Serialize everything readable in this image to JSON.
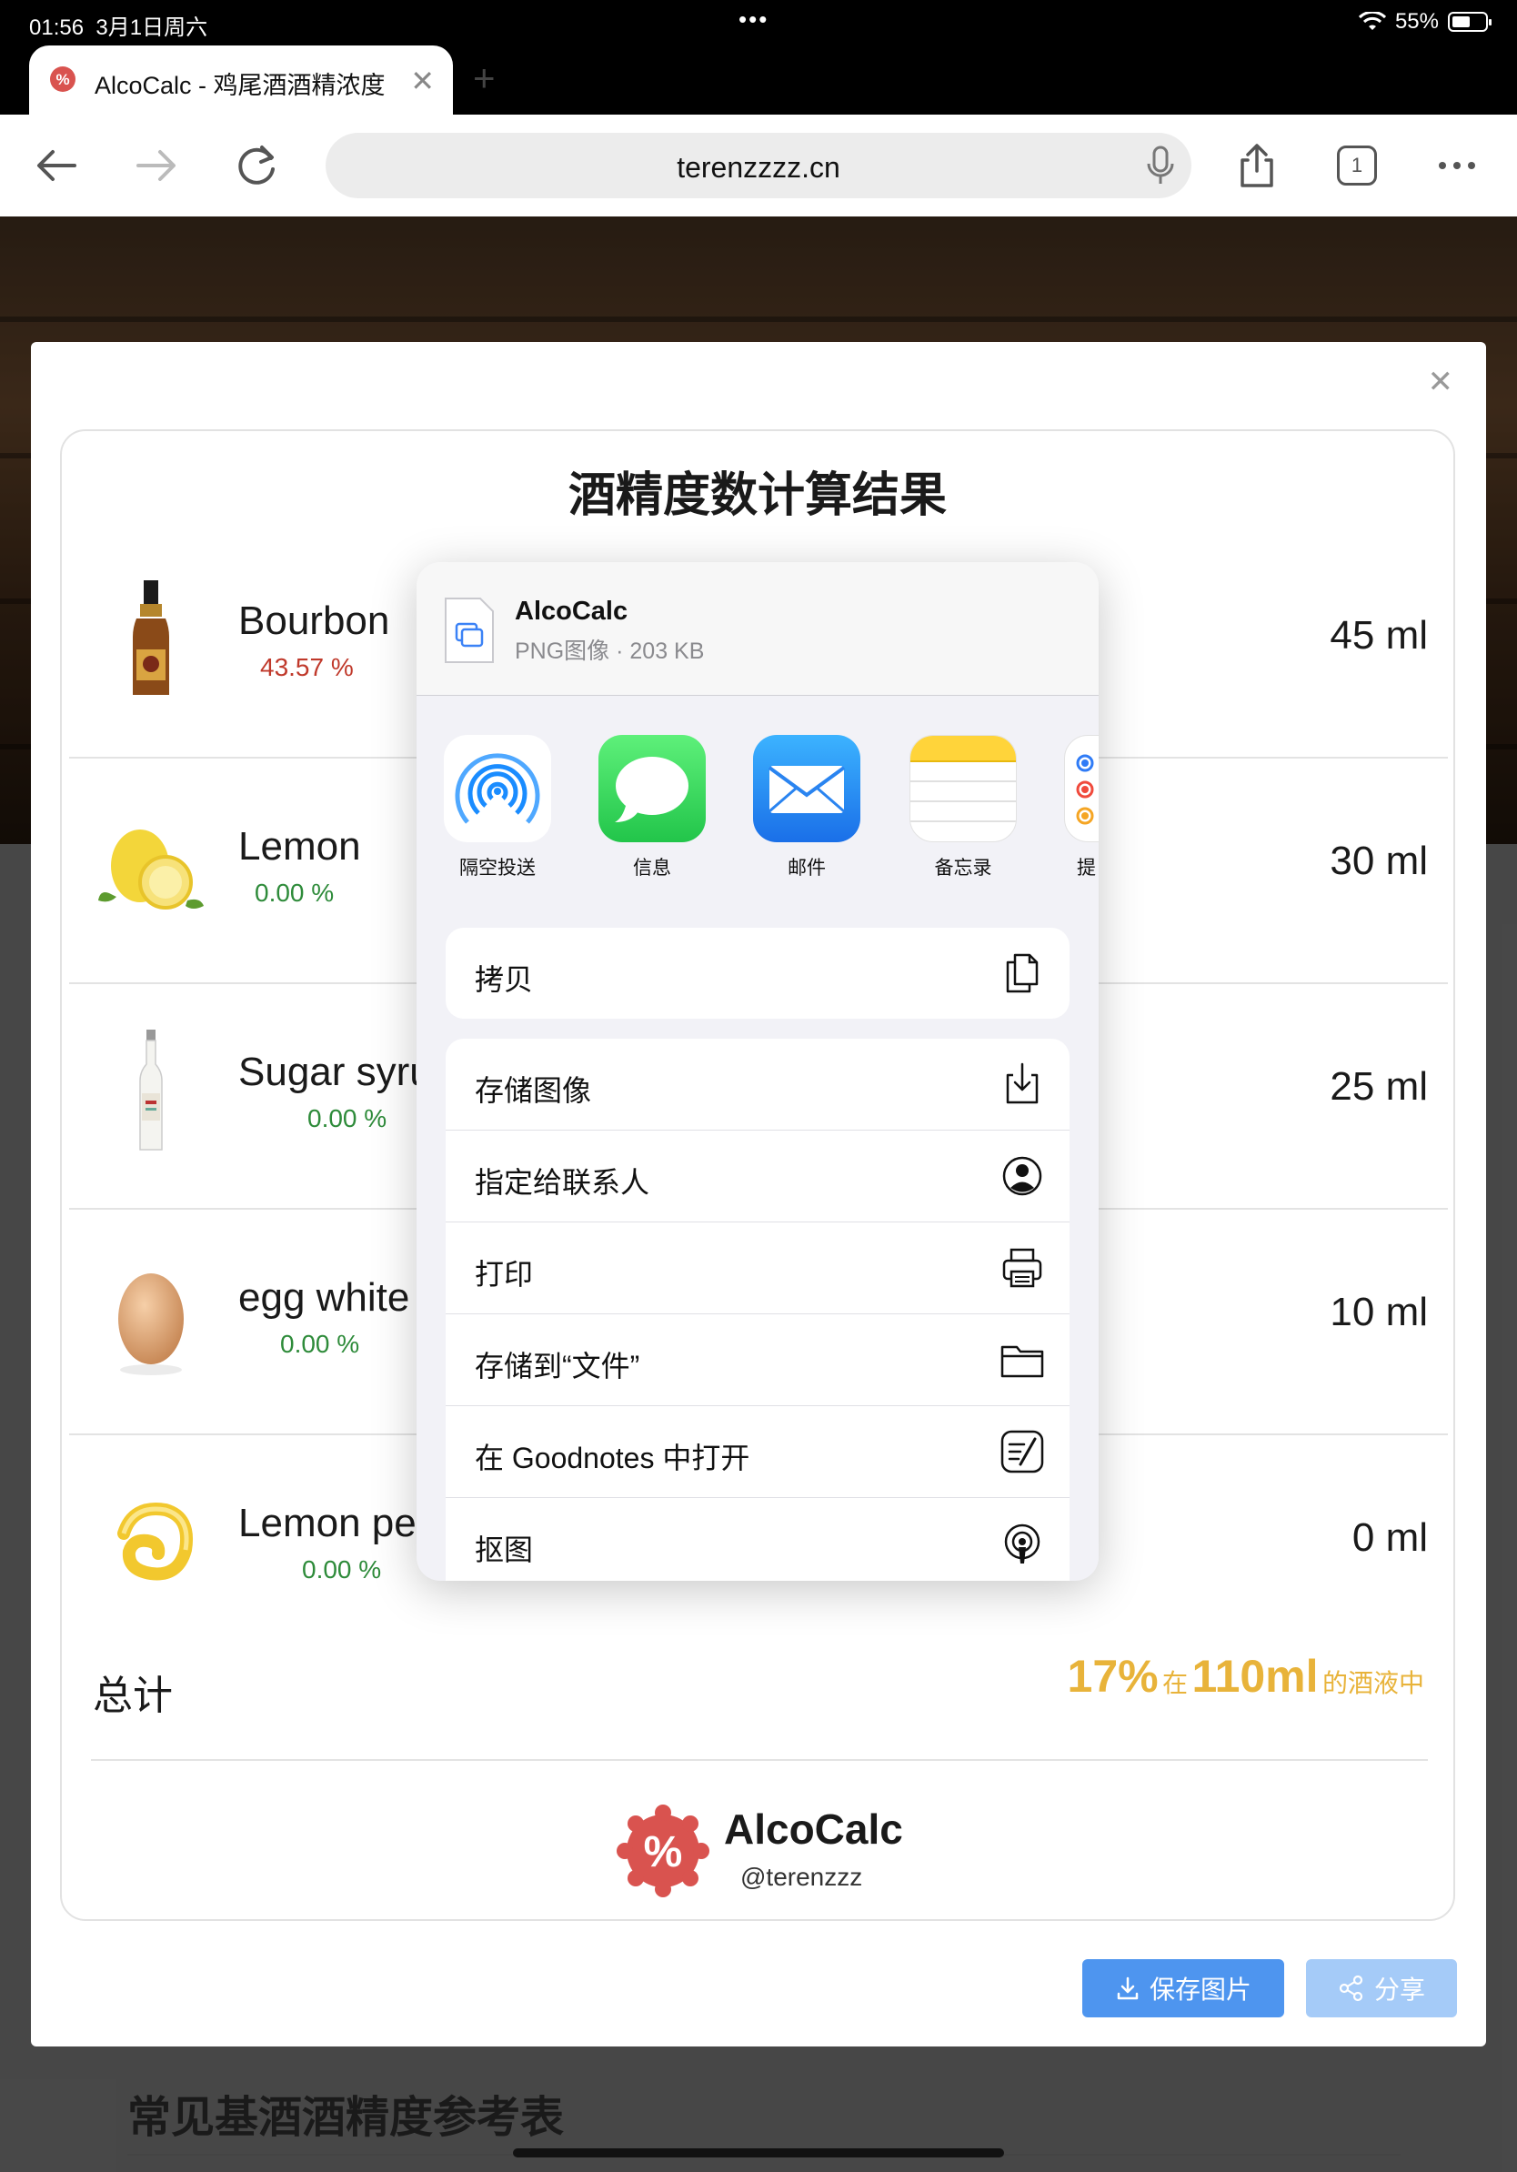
{
  "status_bar": {
    "time": "01:56",
    "date": "3月1日周六",
    "dots": "•••",
    "wifi": "wifi-icon",
    "battery": "55%",
    "battery_level": 0.55
  },
  "tab": {
    "title": "AlcoCalc - 鸡尾酒酒精浓度",
    "new_tab": "+"
  },
  "toolbar": {
    "url": "terenzzzz.cn",
    "tab_count": "1"
  },
  "modal": {
    "title": "酒精度数计算结果",
    "ingredients": [
      {
        "name": "Bourbon",
        "abv": "43.57 %",
        "volume": "45 ml",
        "abv_color": "#c0392b",
        "icon": "bourbon-bottle"
      },
      {
        "name": "Lemon",
        "abv": "0.00 %",
        "volume": "30 ml",
        "abv_color": "#2e8b3a",
        "icon": "lemon"
      },
      {
        "name": "Sugar syru",
        "abv": "0.00 %",
        "volume": "25 ml",
        "abv_color": "#2e8b3a",
        "icon": "syrup-bottle"
      },
      {
        "name": "egg white",
        "abv": "0.00 %",
        "volume": "10 ml",
        "abv_color": "#2e8b3a",
        "icon": "egg"
      },
      {
        "name": "Lemon pee",
        "abv": "0.00 %",
        "volume": "0 ml",
        "abv_color": "#2e8b3a",
        "icon": "lemon-peel"
      }
    ],
    "total": {
      "label": "总计",
      "percent": "17%",
      "in": "在",
      "volume": "110ml",
      "suffix": "的酒液中",
      "color": "#e8b33a"
    },
    "brand": {
      "name": "AlcoCalc",
      "handle": "@terenzzz"
    },
    "buttons": {
      "save": "保存图片",
      "share": "分享"
    }
  },
  "share_sheet": {
    "file_name": "AlcoCalc",
    "file_info": "PNG图像 · 203 KB",
    "apps": [
      {
        "label": "隔空投送",
        "icon": "airdrop-icon"
      },
      {
        "label": "信息",
        "icon": "messages-icon"
      },
      {
        "label": "邮件",
        "icon": "mail-icon"
      },
      {
        "label": "备忘录",
        "icon": "notes-icon"
      },
      {
        "label": "提",
        "icon": "reminders-icon"
      }
    ],
    "group1": [
      {
        "label": "拷贝",
        "icon": "copy-icon"
      }
    ],
    "group2": [
      {
        "label": "存储图像",
        "icon": "save-image-icon"
      },
      {
        "label": "指定给联系人",
        "icon": "contact-icon"
      },
      {
        "label": "打印",
        "icon": "print-icon"
      },
      {
        "label": "存储到“文件”",
        "icon": "folder-icon"
      },
      {
        "label": "在 Goodnotes 中打开",
        "icon": "goodnotes-icon"
      },
      {
        "label": "抠图",
        "icon": "cutout-icon"
      }
    ]
  },
  "page": {
    "reference_heading": "常见基酒酒精度参考表"
  },
  "colors": {
    "accent": "#4e95ef",
    "share_button": "#a5cbf8",
    "brand_red": "#d9534f"
  }
}
